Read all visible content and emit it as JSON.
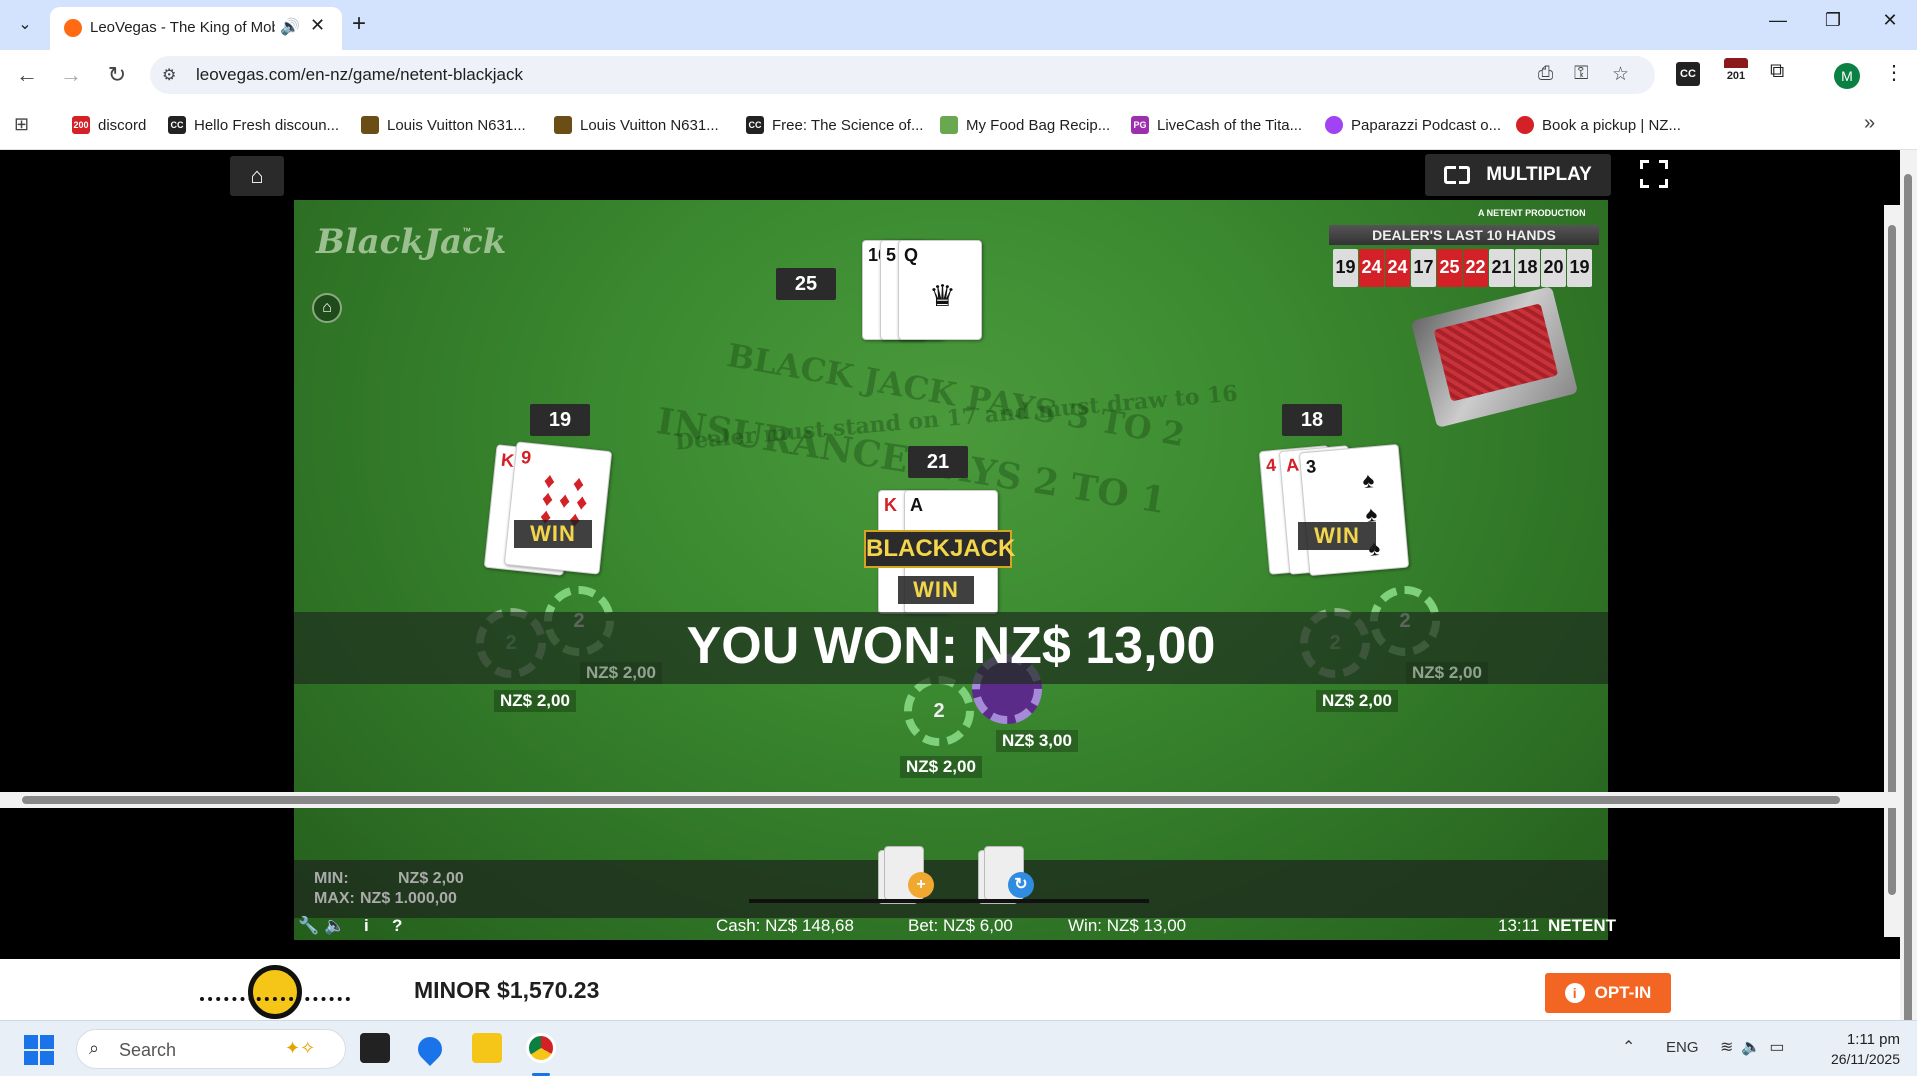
{
  "browser": {
    "tab_title": "LeoVegas - The King of Mobile Casino",
    "url": "leovegas.com/en-nz/game/netent-blackjack",
    "avatar_letter": "M",
    "ext_calendar_num": "201",
    "ext_cc_label": "CC"
  },
  "bookmarks": [
    {
      "label": "discord",
      "icon_color": "#d42027",
      "badge": "200"
    },
    {
      "label": "Hello Fresh discoun...",
      "icon_color": "#222",
      "badge": "CC"
    },
    {
      "label": "Louis Vuitton N631...",
      "icon_color": "#6b4e16",
      "badge": ""
    },
    {
      "label": "Louis Vuitton N631...",
      "icon_color": "#6b4e16",
      "badge": ""
    },
    {
      "label": "Free: The Science of...",
      "icon_color": "#222",
      "badge": "CC"
    },
    {
      "label": "My Food Bag Recip...",
      "icon_color": "#6aa84f",
      "badge": ""
    },
    {
      "label": "LiveCash of the Tita...",
      "icon_color": "#9b2fae",
      "badge": "PG"
    },
    {
      "label": "Paparazzi Podcast o...",
      "icon_color": "#a142f4",
      "badge": ""
    },
    {
      "label": "Book a pickup | NZ...",
      "icon_color": "#d42027",
      "badge": ""
    }
  ],
  "game": {
    "multiplay_label": "MULTIPLAY",
    "logo_text": "BlackJack",
    "logo_tm": "™",
    "production_label": "A NETENT PRODUCTION",
    "dealer_history_title": "DEALER'S LAST 10 HANDS",
    "dealer_history": [
      {
        "v": "19",
        "bust": false
      },
      {
        "v": "24",
        "bust": true
      },
      {
        "v": "24",
        "bust": true
      },
      {
        "v": "17",
        "bust": false
      },
      {
        "v": "25",
        "bust": true
      },
      {
        "v": "22",
        "bust": true
      },
      {
        "v": "21",
        "bust": false
      },
      {
        "v": "18",
        "bust": false
      },
      {
        "v": "20",
        "bust": false
      },
      {
        "v": "19",
        "bust": false
      }
    ],
    "table_text_1": "BLACK JACK PAYS 3 TO 2",
    "table_text_2": "Dealer must stand on 17 and must draw to 16",
    "table_text_3": "INSURANCE PAYS 2 TO 1",
    "dealer": {
      "score": "25",
      "cards": [
        {
          "rank": "10",
          "suit": "♣"
        },
        {
          "rank": "5",
          "suit": "♣"
        },
        {
          "rank": "Q",
          "suit": "♣"
        }
      ]
    },
    "hands": [
      {
        "score": "19",
        "cards": [
          {
            "rank": "K",
            "suit": "♦"
          },
          {
            "rank": "9",
            "suit": "♦"
          }
        ],
        "result": "WIN",
        "chip": "2",
        "bet": "NZ$ 2,00",
        "ghost_chip": "2",
        "ghost_bet": "NZ$ 2,00"
      },
      {
        "score": "21",
        "cards": [
          {
            "rank": "K",
            "suit": "♦"
          },
          {
            "rank": "A",
            "suit": "♠"
          }
        ],
        "result": "WIN",
        "badge": "BLACKJACK",
        "chip": "2",
        "bet": "NZ$ 2,00",
        "payout_bet": "NZ$ 3,00"
      },
      {
        "score": "18",
        "cards": [
          {
            "rank": "4",
            "suit": "♠"
          },
          {
            "rank": "A",
            "suit": "♠"
          },
          {
            "rank": "3",
            "suit": "♠"
          }
        ],
        "result": "WIN",
        "chip": "2",
        "bet": "NZ$ 2,00",
        "ghost_chip": "2",
        "ghost_bet": "NZ$ 2,00"
      }
    ],
    "result_message": "YOU WON: NZ$ 13,00",
    "limits": {
      "min_label": "MIN:",
      "min_value": "NZ$ 2,00",
      "max_label": "MAX:",
      "max_value": "NZ$ 1.000,00"
    },
    "status": {
      "cash": "Cash: NZ$ 148,68",
      "bet": "Bet: NZ$ 6,00",
      "win": "Win: NZ$ 13,00",
      "time": "13:11",
      "brand": "NETENT"
    },
    "colors": {
      "felt": "#3b8a30",
      "win_text": "#f3d64a",
      "bust": "#d42027"
    }
  },
  "promo": {
    "jackpot": "MINOR $1,570.23",
    "optin_label": "OPT-IN"
  },
  "taskbar": {
    "search_placeholder": "Search",
    "lang": "ENG",
    "time": "1:11 pm",
    "date": "26/11/2025"
  }
}
